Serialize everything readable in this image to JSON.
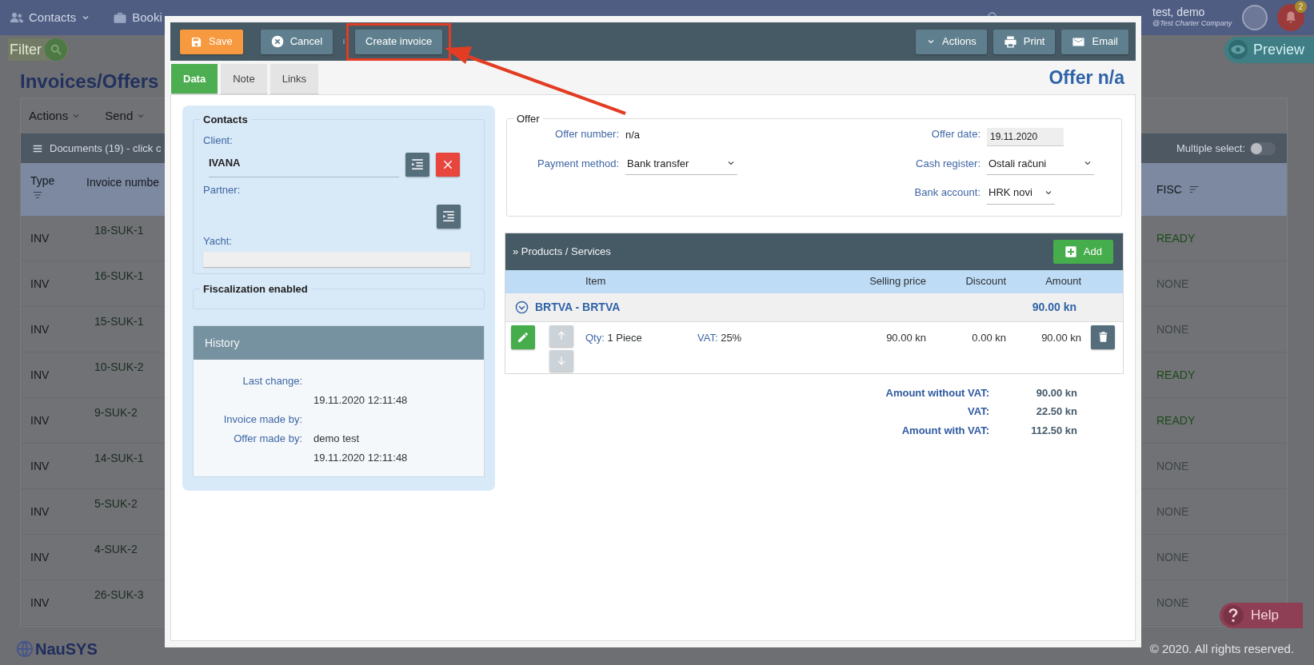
{
  "topbar": {
    "nav": [
      {
        "label": "Contacts",
        "dropdown": true
      },
      {
        "label": "Booki",
        "dropdown": false
      }
    ],
    "user": {
      "name": "test, demo",
      "company": "@Test Charter Company"
    },
    "notifications": "2"
  },
  "toolbar": {
    "filter": "Filter",
    "preview": "Preview"
  },
  "page_title": "Invoices/Offers",
  "page_actions": [
    "Actions",
    "Send"
  ],
  "documents": {
    "title": "Documents (19) - click c",
    "multiple_select": {
      "label": "Multiple select:",
      "on": false
    },
    "columns": [
      "Type",
      "Invoice numbe",
      "FISC"
    ],
    "rows": [
      {
        "type": "INV",
        "number": "18-SUK-1",
        "fisc": "READY",
        "color": "#1d4a1a"
      },
      {
        "type": "INV",
        "number": "16-SUK-1",
        "fisc": "NONE",
        "color": "#3f4448"
      },
      {
        "type": "INV",
        "number": "15-SUK-1",
        "fisc": "NONE",
        "color": "#3f4448"
      },
      {
        "type": "INV",
        "number": "10-SUK-2",
        "fisc": "READY",
        "color": "#1d4a1a"
      },
      {
        "type": "INV",
        "number": "9-SUK-2",
        "fisc": "READY",
        "color": "#1d4a1a"
      },
      {
        "type": "INV",
        "number": "14-SUK-1",
        "fisc": "NONE",
        "color": "#3f4448"
      },
      {
        "type": "INV",
        "number": "5-SUK-2",
        "fisc": "NONE",
        "color": "#3f4448"
      },
      {
        "type": "INV",
        "number": "4-SUK-2",
        "fisc": "NONE",
        "color": "#3f4448"
      },
      {
        "type": "INV",
        "number": "26-SUK-3",
        "fisc": "NONE",
        "color": "#3f4448"
      }
    ]
  },
  "help": "Help",
  "footer": {
    "logo": "NauSYS",
    "copyright": "© 2020. All rights reserved."
  },
  "modal": {
    "toolbar": {
      "left": [
        {
          "label": "Save",
          "kind": "save",
          "highlighted": false
        },
        {
          "label": "Cancel",
          "kind": "cancel",
          "highlighted": false
        },
        {
          "label": "Create invoice",
          "kind": "plain",
          "highlighted": true
        }
      ],
      "right": [
        {
          "label": "Actions",
          "kind": "dropdown"
        },
        {
          "label": "Print",
          "kind": "print"
        },
        {
          "label": "Email",
          "kind": "email"
        }
      ]
    },
    "tabs": [
      {
        "label": "Data",
        "selected": true
      },
      {
        "label": "Note",
        "selected": false
      },
      {
        "label": "Links",
        "selected": false
      }
    ],
    "title": "Offer n/a",
    "contacts": {
      "legend": "Contacts",
      "client_label": "Client:",
      "client": "IVANA",
      "partner_label": "Partner:",
      "yacht_label": "Yacht:"
    },
    "fiscalization": "Fiscalization enabled",
    "history": {
      "title": "History",
      "rows": [
        {
          "label": "Last change:"
        },
        {
          "value": "19.11.2020 12:11:48"
        },
        {
          "label": "Invoice made by:"
        },
        {
          "label": "Offer made by:",
          "value": "demo test"
        },
        {
          "value": "19.11.2020 12:11:48"
        }
      ]
    },
    "offer": {
      "legend": "Offer",
      "left": [
        {
          "label": "Offer number:",
          "value": "n/a",
          "kind": "text"
        },
        {
          "label": "Payment method:",
          "value": "Bank transfer",
          "kind": "select"
        }
      ],
      "right": [
        {
          "label": "Offer date:",
          "value": "19.11.2020",
          "kind": "input"
        },
        {
          "label": "Cash register:",
          "value": "Ostali računi",
          "kind": "select"
        },
        {
          "label": "Bank account:",
          "value": "HRK novi",
          "kind": "select"
        }
      ]
    },
    "products": {
      "title": "» Products / Services",
      "add": "Add",
      "columns": [
        "Item",
        "Selling price",
        "Discount",
        "Amount"
      ],
      "groups": [
        {
          "name": "BRTVA - BRTVA",
          "amount": "90.00 kn",
          "expanded": true,
          "items": [
            {
              "qty_label": "Qty:",
              "qty": "1 Piece",
              "vat_label": "VAT:",
              "vat": "25%",
              "price": "90.00 kn",
              "discount": "0.00 kn",
              "amount": "90.00 kn"
            }
          ]
        }
      ]
    },
    "totals": [
      {
        "label": "Amount without VAT:",
        "value": "90.00 kn"
      },
      {
        "label": "VAT:",
        "value": "22.50 kn"
      },
      {
        "label": "Amount with VAT:",
        "value": "112.50 kn"
      }
    ]
  }
}
